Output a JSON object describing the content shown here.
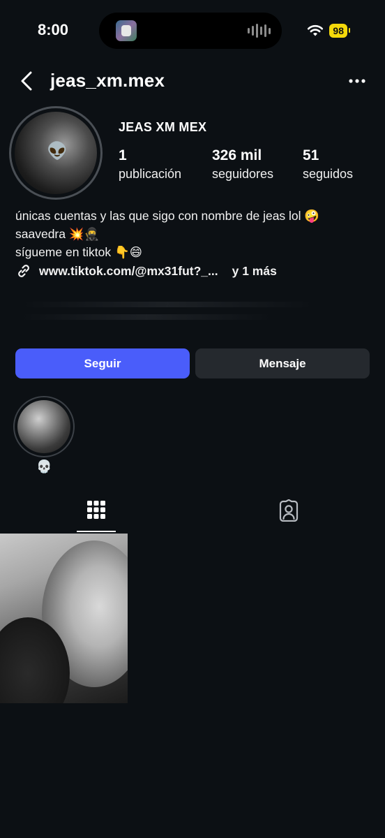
{
  "status_bar": {
    "time": "8:00",
    "battery": "98",
    "wifi_icon": "wifi-icon",
    "accent": "#f5d90a"
  },
  "header": {
    "username": "jeas_xm.mex",
    "back_icon": "chevron-left-icon",
    "more_icon": "more-horizontal-icon"
  },
  "profile": {
    "display_name": "JEAS XM MEX",
    "stats": [
      {
        "value": "1",
        "label": "publicación"
      },
      {
        "value": "326 mil",
        "label": "seguidores"
      },
      {
        "value": "51",
        "label": "seguidos"
      }
    ],
    "avatar_emoji": "👽",
    "bio_lines": [
      "únicas cuentas y las que sigo con nombre de jeas lol 🤪",
      "saavedra  💥🥷",
      "sígueme en tiktok  👇😄"
    ],
    "link_text": "www.tiktok.com/@mx31fut?_...",
    "link_more": "y 1 más"
  },
  "actions": {
    "follow_label": "Seguir",
    "message_label": "Mensaje",
    "follow_color": "#4a5dfa",
    "message_color": "#25292e"
  },
  "highlights": [
    {
      "label": "💀"
    }
  ],
  "tabs": [
    {
      "icon": "grid-icon",
      "active": true
    },
    {
      "icon": "tagged-person-icon",
      "active": false
    }
  ]
}
